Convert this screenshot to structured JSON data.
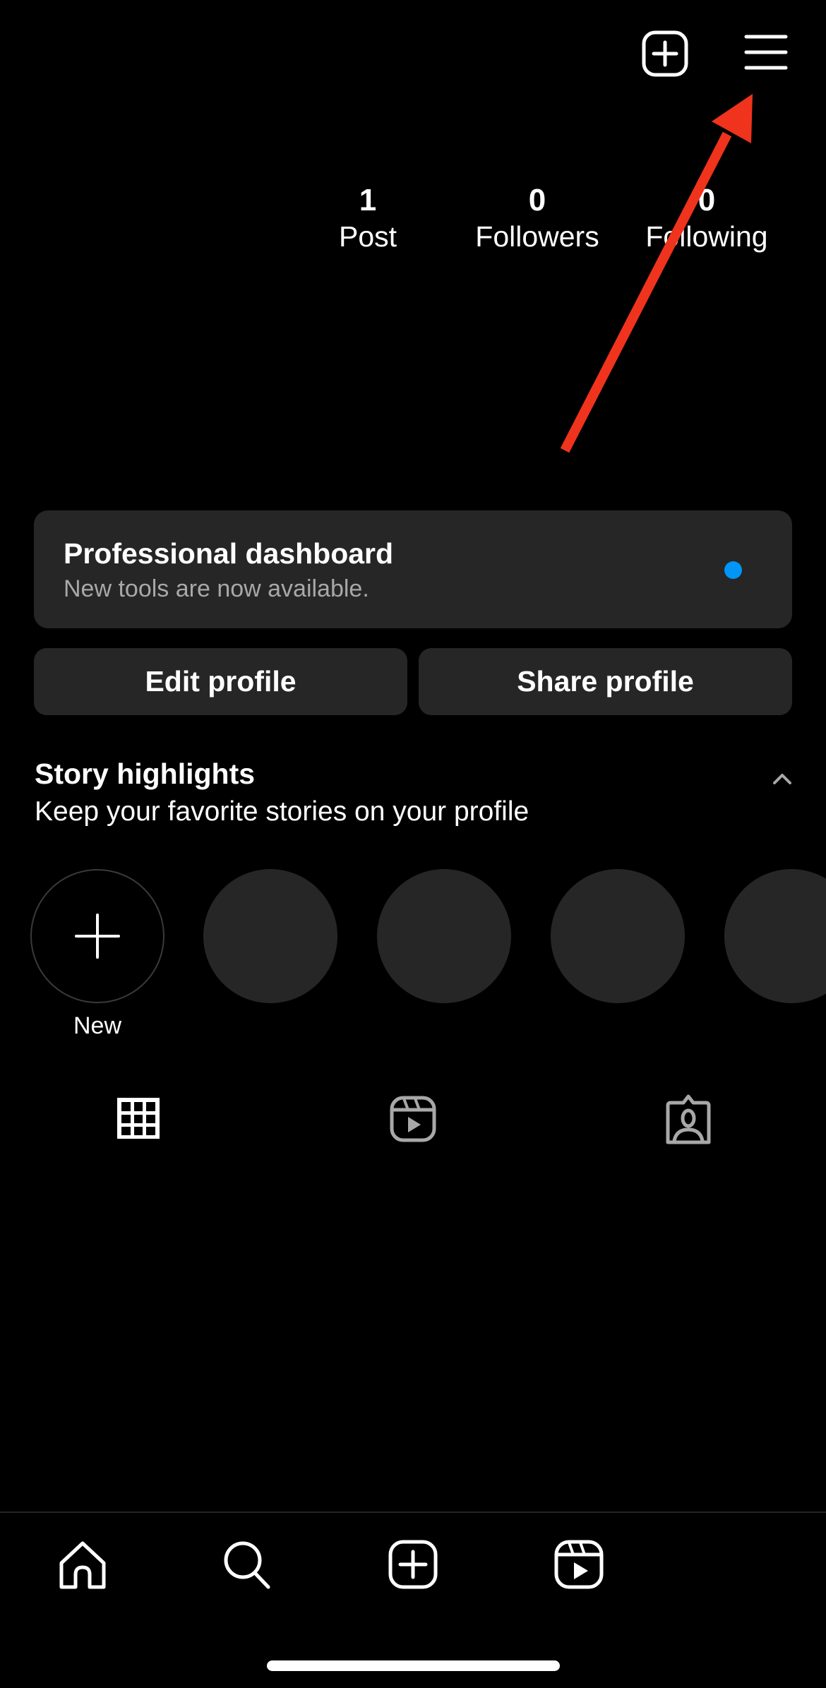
{
  "header": {
    "create_icon": "plus-square-icon",
    "menu_icon": "hamburger-menu-icon"
  },
  "stats": [
    {
      "value": "1",
      "label": "Post"
    },
    {
      "value": "0",
      "label": "Followers"
    },
    {
      "value": "0",
      "label": "Following"
    }
  ],
  "dashboard": {
    "title": "Professional dashboard",
    "subtitle": "New tools are now available.",
    "indicator_color": "#0095f6"
  },
  "actions": {
    "edit_label": "Edit profile",
    "share_label": "Share profile"
  },
  "story_highlights": {
    "title": "Story highlights",
    "subtitle": "Keep your favorite stories on your profile",
    "new_label": "New",
    "placeholder_count": 4
  },
  "content_tabs": [
    {
      "name": "posts-grid",
      "icon": "grid-icon",
      "active": true
    },
    {
      "name": "reels",
      "icon": "reels-icon",
      "active": false
    },
    {
      "name": "tagged",
      "icon": "tagged-person-icon",
      "active": false
    }
  ],
  "bottom_nav": [
    {
      "name": "home",
      "icon": "home-icon"
    },
    {
      "name": "search",
      "icon": "search-icon"
    },
    {
      "name": "create",
      "icon": "plus-square-icon"
    },
    {
      "name": "reels",
      "icon": "reels-icon"
    }
  ],
  "annotation": {
    "type": "arrow",
    "color": "#f0331c",
    "points_to": "hamburger-menu-icon"
  },
  "colors": {
    "background": "#000000",
    "surface": "#262626",
    "muted_text": "#a8a8a8",
    "inactive_icon": "#a8a8a8"
  }
}
